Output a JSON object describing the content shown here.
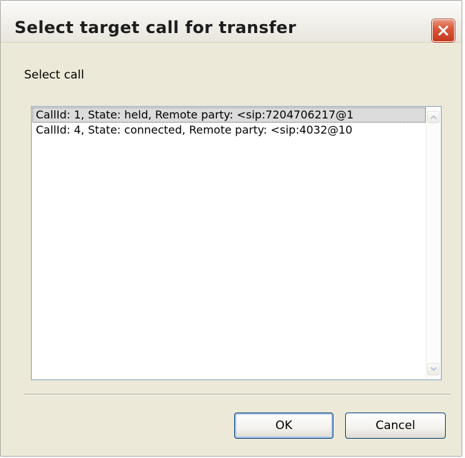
{
  "window": {
    "title": "Select target call for transfer",
    "close_icon": "close-icon"
  },
  "dialog": {
    "label": "Select call",
    "calls": [
      {
        "text": "CallId: 1, State: held, Remote party: <sip:7204706217@1",
        "selected": true
      },
      {
        "text": "CallId: 4, State: connected, Remote party: <sip:4032@10",
        "selected": false
      }
    ],
    "scroll_icons": {
      "up": "chevron-up-icon",
      "down": "chevron-down-icon"
    }
  },
  "buttons": {
    "ok_label": "OK",
    "cancel_label": "Cancel"
  },
  "colors": {
    "accent": "#0a246a",
    "close_button": "#d9583a",
    "selection": "#dcdcdc"
  }
}
